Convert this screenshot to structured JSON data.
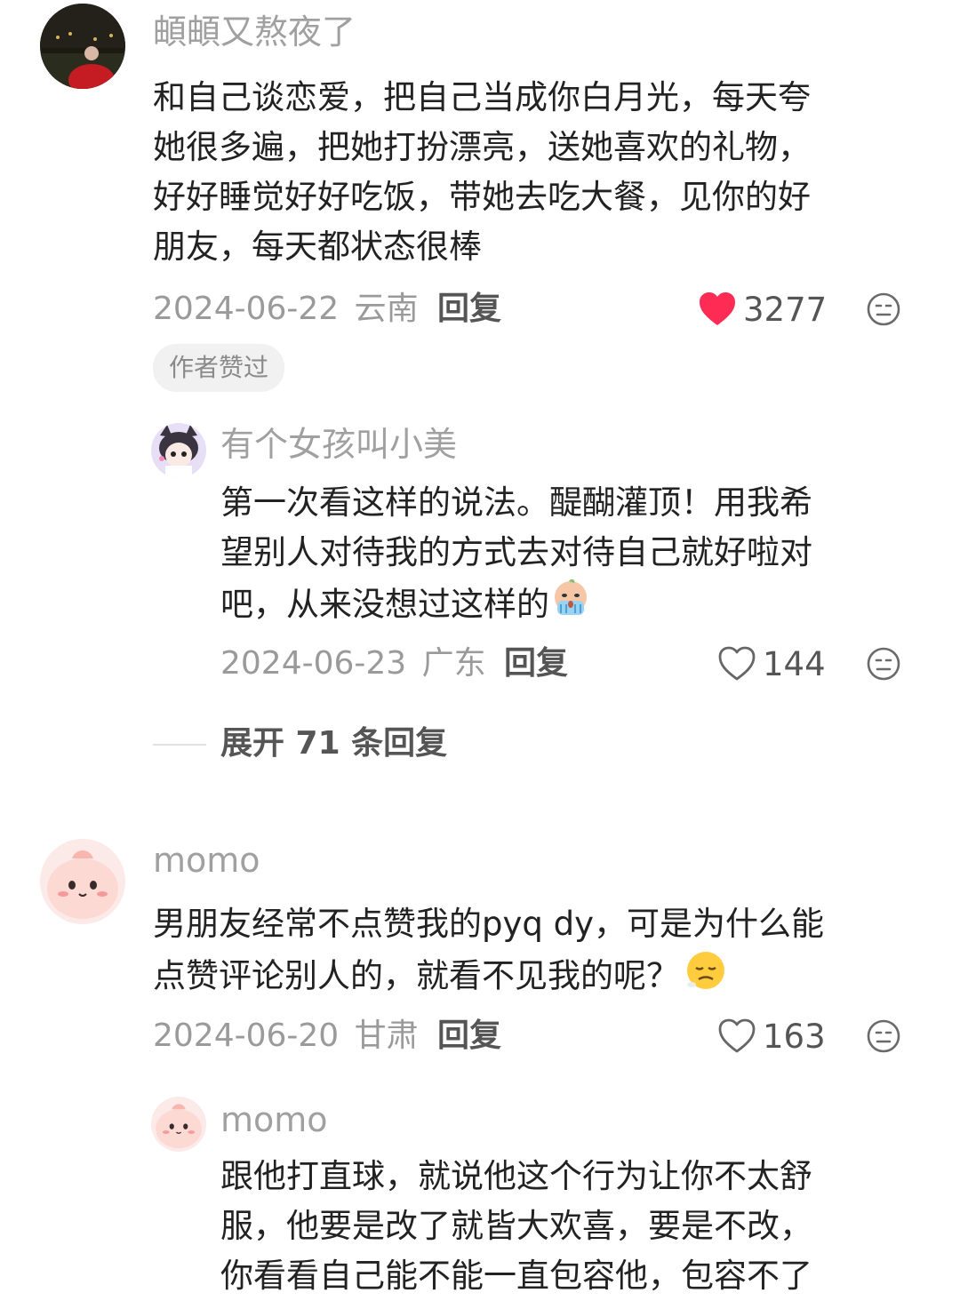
{
  "comments": [
    {
      "username": "頔頔又熬夜了",
      "avatar_icon": "night-photo-avatar",
      "text_lines": [
        "和自己谈恋爱，把自己当成你白月光，每天夸",
        "她很多遍，把她打扮漂亮，送她喜欢的礼物，",
        "好好睡觉好好吃饭，带她去吃大餐，见你的好",
        "朋友，每天都状态很棒"
      ],
      "date": "2024-06-22",
      "location": "云南",
      "reply_label": "回复",
      "likes": "3277",
      "liked": true,
      "badge": "作者赞过",
      "replies": [
        {
          "username": "有个女孩叫小美",
          "avatar_icon": "anime-cat-girl-avatar",
          "text_lines": [
            "第一次看这样的说法。醍醐灌顶！用我希",
            "望别人对待我的方式去对待自己就好啦对",
            "吧，从来没想过这样的"
          ],
          "emoji": "crying-emoji",
          "date": "2024-06-23",
          "location": "广东",
          "reply_label": "回复",
          "likes": "144",
          "liked": false
        }
      ],
      "expand_label": "展开 71 条回复"
    },
    {
      "username": "momo",
      "avatar_icon": "pink-blob-avatar",
      "text_lines": [
        "男朋友经常不点赞我的pyq dy，可是为什么能",
        "点赞评论别人的，就看不见我的呢？"
      ],
      "emoji": "sad-face-emoji",
      "date": "2024-06-20",
      "location": "甘肃",
      "reply_label": "回复",
      "likes": "163",
      "liked": false,
      "replies": [
        {
          "username": "momo",
          "avatar_icon": "pink-blob-avatar",
          "text_lines": [
            "跟他打直球，就说他这个行为让你不太舒",
            "服，他要是改了就皆大欢喜，要是不改，",
            "你看看自己能不能一直包容他，包容不了"
          ]
        }
      ]
    }
  ],
  "colors": {
    "heart_liked": "#fe2c55",
    "meta_gray": "#9a9a9a",
    "text": "#222222"
  }
}
